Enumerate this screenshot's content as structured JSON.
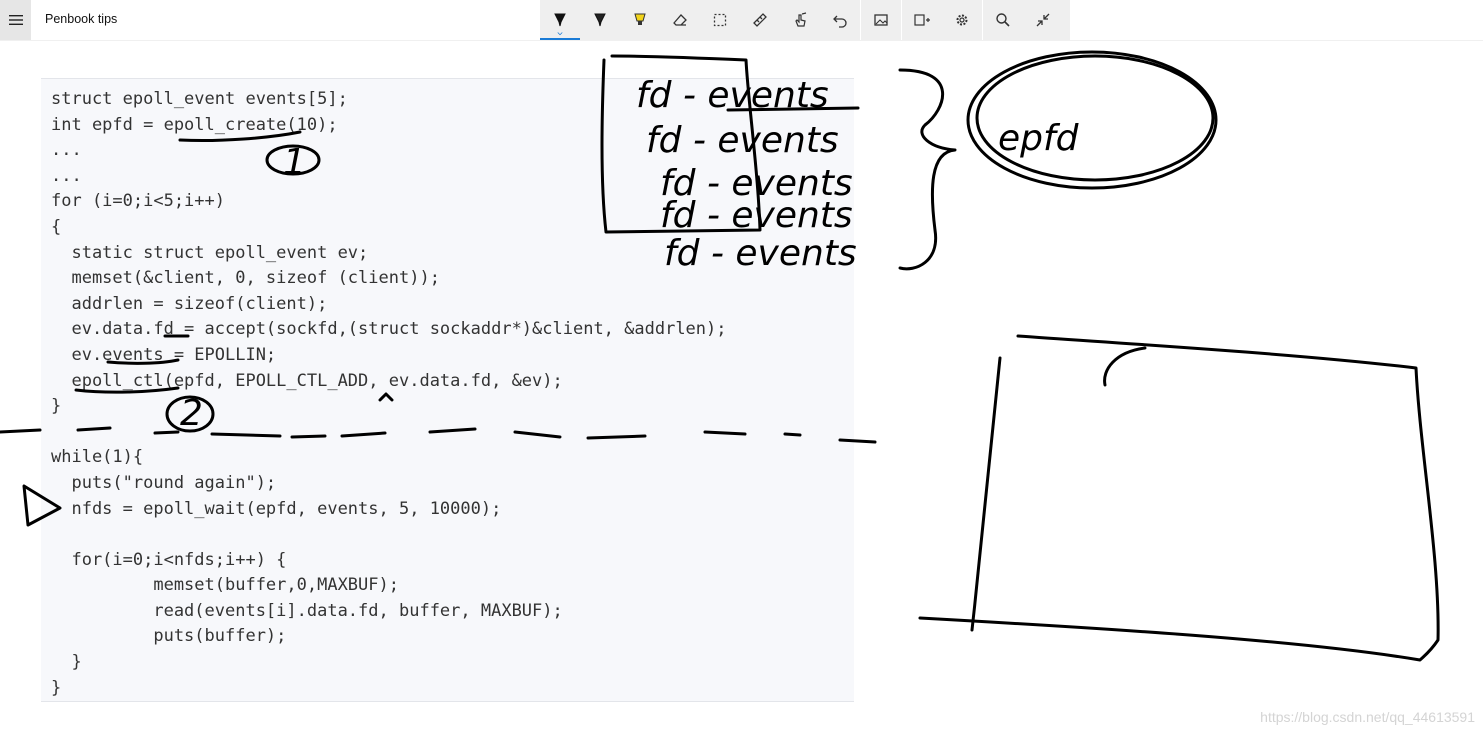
{
  "app": {
    "title": "Penbook tips"
  },
  "toolbar": {
    "tools": [
      "ballpoint-pen",
      "pencil",
      "highlighter",
      "eraser",
      "lasso-select",
      "ruler",
      "touch-writing",
      "undo",
      "image",
      "add-page",
      "settings",
      "search",
      "exit-fullscreen"
    ]
  },
  "code": {
    "lines": [
      "struct epoll_event events[5];",
      "int epfd = epoll_create(10);",
      "...",
      "...",
      "for (i=0;i<5;i++)",
      "{",
      "  static struct epoll_event ev;",
      "  memset(&client, 0, sizeof (client));",
      "  addrlen = sizeof(client);",
      "  ev.data.fd = accept(sockfd,(struct sockaddr*)&client, &addrlen);",
      "  ev.events = EPOLLIN;",
      "  epoll_ctl(epfd, EPOLL_CTL_ADD, ev.data.fd, &ev);",
      "}",
      "",
      "while(1){",
      "  puts(\"round again\");",
      "  nfds = epoll_wait(epfd, events, 5, 10000);",
      "",
      "  for(i=0;i<nfds;i++) {",
      "          memset(buffer,0,MAXBUF);",
      "          read(events[i].data.fd, buffer, MAXBUF);",
      "          puts(buffer);",
      "  }",
      "}"
    ]
  },
  "ink": {
    "list": [
      "fd - events",
      "fd - events",
      "fd - events",
      "fd - events",
      "fd - events"
    ],
    "circle_label": "epfd",
    "marker_1": "1",
    "marker_2": "2"
  },
  "watermark": "https://blog.csdn.net/qq_44613591"
}
